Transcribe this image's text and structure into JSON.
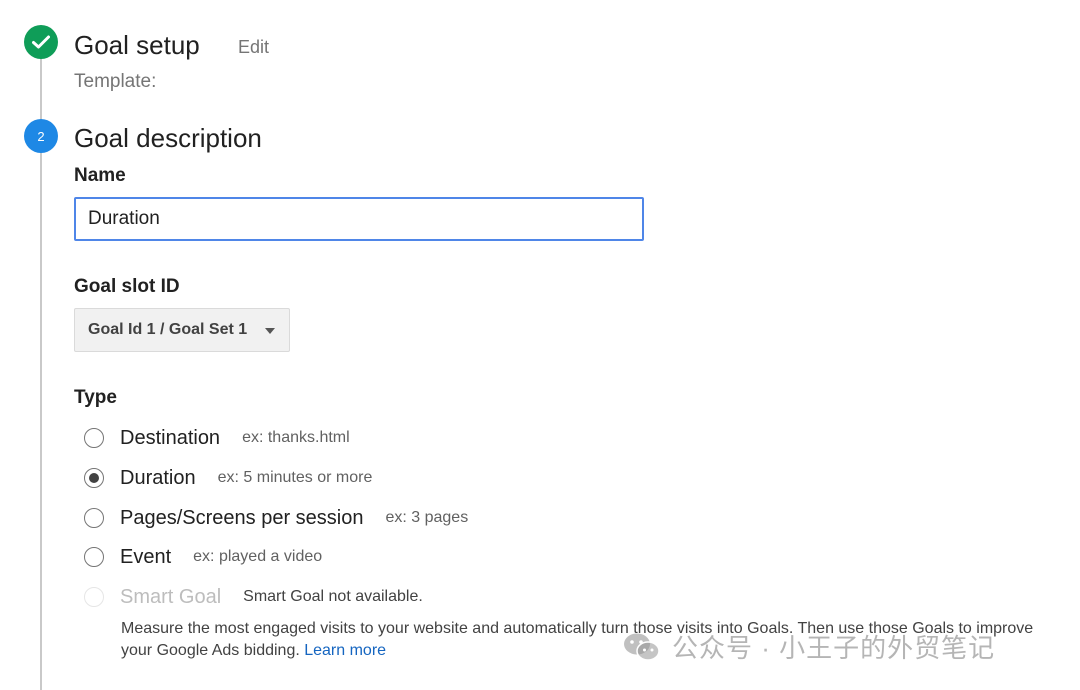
{
  "steps": {
    "goal_setup": {
      "title": "Goal setup",
      "edit_label": "Edit",
      "template_label": "Template:"
    },
    "goal_description": {
      "number": "2",
      "title": "Goal description"
    }
  },
  "name_field": {
    "label": "Name",
    "value": "Duration"
  },
  "goal_slot": {
    "label": "Goal slot ID",
    "selected": "Goal Id 1 / Goal Set 1"
  },
  "type": {
    "label": "Type",
    "options": [
      {
        "label": "Destination",
        "example": "ex: thanks.html",
        "checked": false,
        "disabled": false
      },
      {
        "label": "Duration",
        "example": "ex: 5 minutes or more",
        "checked": true,
        "disabled": false
      },
      {
        "label": "Pages/Screens per session",
        "example": "ex: 3 pages",
        "checked": false,
        "disabled": false
      },
      {
        "label": "Event",
        "example": "ex: played a video",
        "checked": false,
        "disabled": false
      },
      {
        "label": "Smart Goal",
        "example": "Smart Goal not available.",
        "checked": false,
        "disabled": true
      }
    ],
    "smart_goal_description": "Measure the most engaged visits to your website and automatically turn those visits into Goals. Then use those Goals to improve your Google Ads bidding.",
    "learn_more": "Learn more"
  },
  "watermark": {
    "text": "公众号 · 小王子的外贸笔记"
  },
  "colors": {
    "step_done": "#0f9d58",
    "step_active": "#1e88e5",
    "input_focus": "#4f86e8",
    "link": "#1565c0"
  }
}
